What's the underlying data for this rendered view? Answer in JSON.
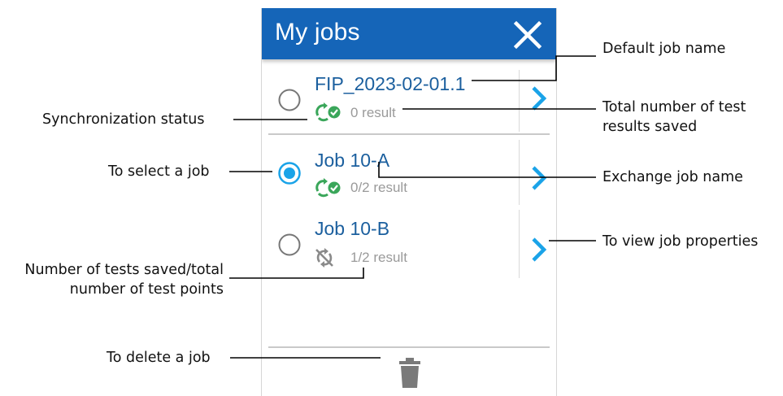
{
  "header": {
    "title": "My jobs"
  },
  "jobs": [
    {
      "name": "FIP_2023-02-01.1",
      "count": "0 result",
      "selected": false,
      "sync": "synced"
    },
    {
      "name": "Job 10-A",
      "count": "0/2 result",
      "selected": true,
      "sync": "synced"
    },
    {
      "name": "Job 10-B",
      "count": "1/2 result",
      "selected": false,
      "sync": "not-synced"
    }
  ],
  "callouts": {
    "default_job_name": "Default job name",
    "sync_status": "Synchronization status",
    "total_results_line1": "Total number of test",
    "total_results_line2": "results saved",
    "select_job": "To select a job",
    "exchange_job_name": "Exchange job name",
    "view_properties": "To view job properties",
    "tests_saved_line1": "Number of tests saved/total",
    "tests_saved_line2": "number of test points",
    "delete_job": "To delete a job"
  },
  "colors": {
    "header": "#1565b8",
    "job_name": "#1b5f9e",
    "accent": "#1aa3e8",
    "sync_green": "#3aa65a",
    "muted": "#9a9a9a"
  },
  "icons": {
    "close": "close-icon",
    "synced": "sync-check-icon",
    "not_synced": "sync-off-icon",
    "chevron": "chevron-right-icon",
    "trash": "trash-icon"
  }
}
